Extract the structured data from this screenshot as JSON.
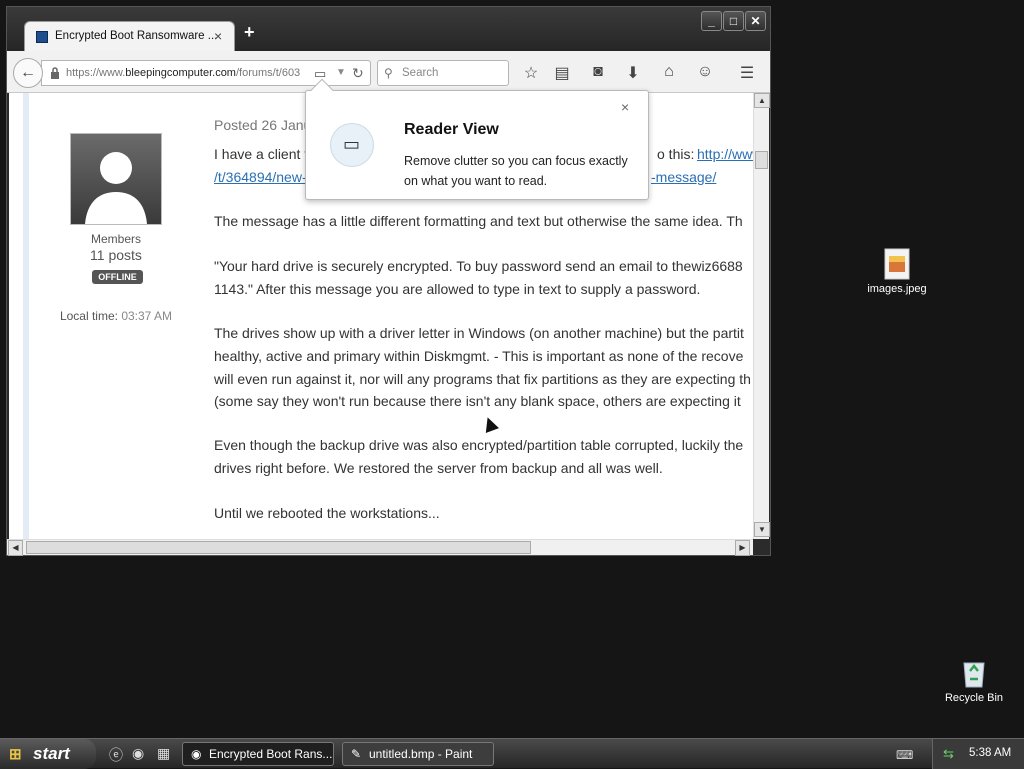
{
  "browser": {
    "tab_title": "Encrypted Boot Ransomware ...",
    "tab_close": "×",
    "new_tab": "+",
    "window_buttons": {
      "minimize": "_",
      "maximize": "□",
      "close": "✕"
    },
    "url_prefix": "https://www.",
    "url_domain": "bleepingcomputer.com",
    "url_suffix": "/forums/t/603",
    "search_placeholder": "Search"
  },
  "profile": {
    "group": "Members",
    "posts": "11 posts",
    "status": "OFFLINE",
    "local_time_label": "Local time:",
    "local_time_value": "03:37 AM"
  },
  "post": {
    "posted": "Posted 26 Janu",
    "line1": "I have a client t",
    "line1_right": "o this: ",
    "line1_link": "http://www",
    "line2_link_left": "/t/364894/new-",
    "line2_link_right": "-message/",
    "p2": "The message has a little different formatting and text but otherwise the same idea.  Th",
    "p3a": "\"Your hard drive is securely encrypted.  To buy password send an email to thewiz6688",
    "p3b": "1143.\"  After this message you are allowed to type in text to supply a password.",
    "p4a": "The drives show up with a driver letter in Windows (on another machine) but the partit",
    "p4b": "healthy, active and primary within Diskmgmt.  - This is important as none of the recove",
    "p4c": "will even run against it, nor will any programs that fix partitions as they are expecting th",
    "p4d": "(some say they won't run because there isn't any blank space, others are expecting it",
    "p5a": "Even though the backup drive was also encrypted/partition table corrupted, luckily the",
    "p5b": "drives right before.  We restored the server from backup and all was well.",
    "p6": "Until we rebooted the workstations..."
  },
  "reader_popup": {
    "title": "Reader View",
    "body": "Remove clutter so you can focus exactly on what you want to read.",
    "close": "×"
  },
  "desktop_icons": [
    {
      "label": "images.jpeg"
    },
    {
      "label": "Recycle Bin"
    }
  ],
  "taskbar": {
    "start": "start",
    "tasks": [
      {
        "label": "Encrypted Boot Rans..."
      },
      {
        "label": "untitled.bmp - Paint"
      }
    ],
    "clock": "5:38 AM"
  }
}
